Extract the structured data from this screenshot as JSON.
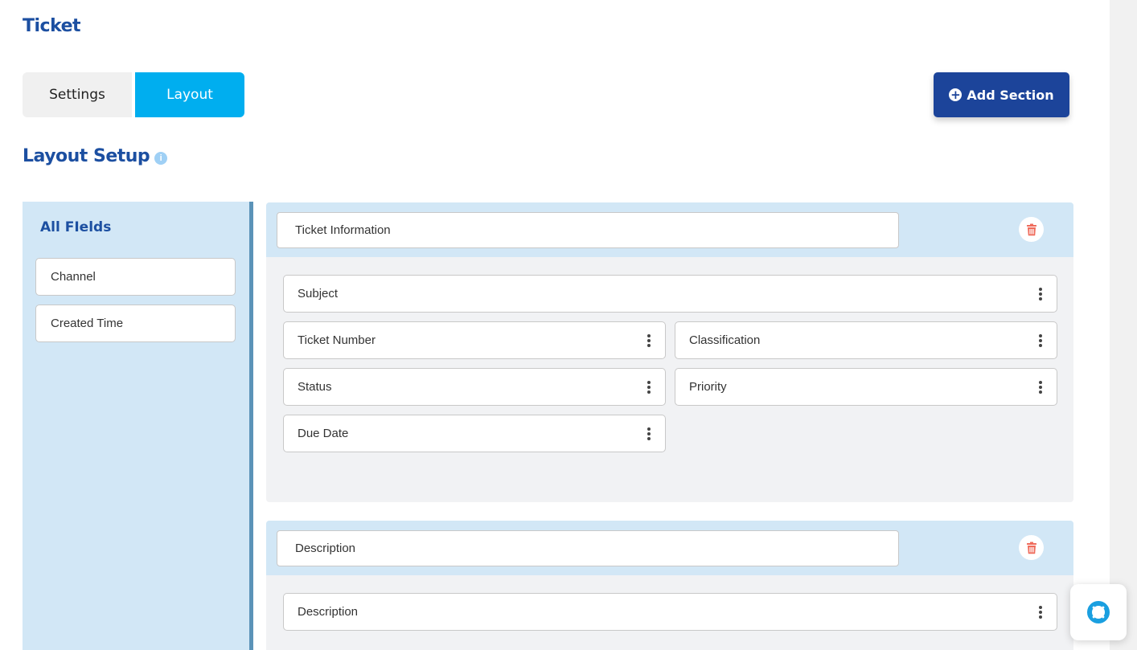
{
  "page": {
    "title": "Ticket"
  },
  "tabs": [
    {
      "label": "Settings",
      "active": false
    },
    {
      "label": "Layout",
      "active": true
    }
  ],
  "toolbar": {
    "add_section_label": "Add Section",
    "add_icon": "plus-circle-icon"
  },
  "layout_setup": {
    "heading": "Layout Setup",
    "info_icon": "info-icon"
  },
  "all_fields": {
    "title": "All FIelds",
    "items": [
      "Channel",
      "Created Time"
    ]
  },
  "sections": [
    {
      "name": "Ticket Information",
      "fields": {
        "subject": "Subject",
        "ticket_number": "Ticket Number",
        "classification": "Classification",
        "status": "Status",
        "priority": "Priority",
        "due_date": "Due Date"
      }
    },
    {
      "name": "Description",
      "fields": {
        "description": "Description"
      }
    }
  ],
  "colors": {
    "brand_blue": "#1c4fa1",
    "tab_active": "#00aeef",
    "add_button": "#1c449a",
    "panel_blue": "#d2e7f6",
    "delete_red": "#ef6b5b",
    "help_icon": "#1a9fe0"
  }
}
